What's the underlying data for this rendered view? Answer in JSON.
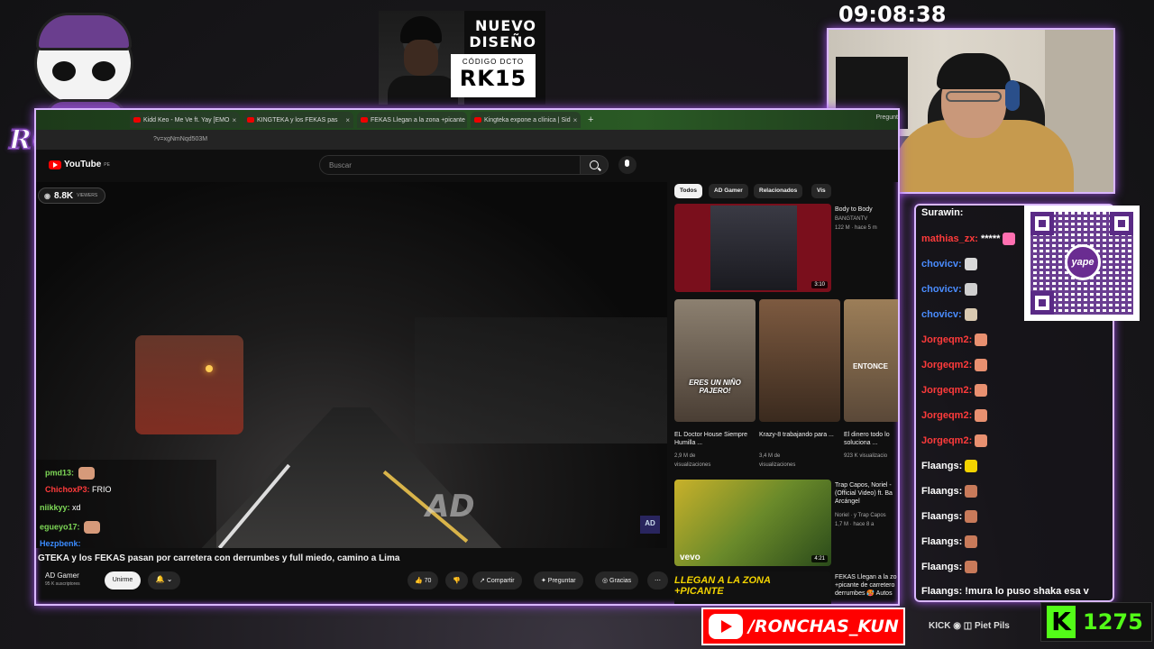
{
  "clock": "09:08:38",
  "logo": {
    "text": "RONCHAS"
  },
  "ad": {
    "line1": "NUEVO",
    "line2": "DISEÑO",
    "code_label": "CÓDIGO DCTO",
    "code": "RK15"
  },
  "browser": {
    "tabs": [
      {
        "label": "Kidd Keo - Me Ve ft. Yay [EMO"
      },
      {
        "label": "KINGTEKA y los FEKAS pas"
      },
      {
        "label": "FEKAS Llegan a la zona +picante"
      },
      {
        "label": "Kingteka expone a clínica | Sid"
      }
    ],
    "new_tab": "+",
    "profile": "Pregunt",
    "url": "?v=xgNmNqd503M"
  },
  "youtube": {
    "logo_text": "YouTube",
    "logo_region": "PE",
    "search_placeholder": "Buscar",
    "viewers": "8.8K",
    "viewers_label": "VIEWERS",
    "watermark": "AD",
    "corner_badge": "AD",
    "video_title": "GTEKA y los FEKAS pasan por carretera con derrumbes y full miedo, camino a Lima",
    "channel": {
      "name": "AD Gamer",
      "subs": "95 K suscriptores"
    },
    "join_label": "Unirme",
    "bell": "🔔 ⌄",
    "actions": {
      "likes": "👍 70",
      "dislike": "👎",
      "share": "↗ Compartir",
      "ask": "✦ Preguntar",
      "thanks": "◎ Gracias",
      "more": "⋯"
    }
  },
  "overlay_chat": [
    {
      "name": "pmd13:",
      "text": "",
      "color": "#7ed957"
    },
    {
      "name": "ChichoxP3:",
      "text": "FRIO",
      "color": "#ff3b3b"
    },
    {
      "name": "niikkyy:",
      "text": "xd",
      "color": "#7ed957"
    },
    {
      "name": "egueyo17:",
      "text": "",
      "color": "#7ed957"
    },
    {
      "name": "Hezpbenk:",
      "text": "",
      "color": "#3b8cff"
    }
  ],
  "recommendations": {
    "chips": [
      "Todos",
      "AD Gamer",
      "Relacionados",
      "Vis"
    ],
    "first": {
      "title": "Body to Body",
      "channel": "BANGTANTV",
      "meta": "122 M · hace 5 m",
      "duration": "3:10"
    },
    "shorts": [
      {
        "caption": "ERES UN NIÑO PAJERO!",
        "title": "EL Doctor House Siempre Humilla ...",
        "views": "2,9 M de",
        "views2": "visualizaciones"
      },
      {
        "caption": "",
        "title": "Krazy-8 trabajando para ...",
        "views": "3,4 M de",
        "views2": "visualizaciones"
      },
      {
        "caption": "ENTONCE",
        "title": "El dinero todo lo soluciona ...",
        "views": "923 K visualizacio",
        "views2": ""
      }
    ],
    "second": {
      "title": "Trap Capos, Noriel - (Official Video) ft. Ba Arcángel",
      "channel": "Noriel · y Trap Capos",
      "meta": "1,7 M · hace 8 a",
      "duration": "4:21",
      "brand": "vevo"
    },
    "third": {
      "banner": "LLEGAN A LA ZONA +PICANTE",
      "title": "FEKAS Llegan a la zo +picante de carretero derrumbes 🥵 Autos"
    }
  },
  "chat": [
    {
      "name": "Surawin:",
      "text": "",
      "color": "#ffffff"
    },
    {
      "name": "mathias_zx:",
      "text": "*****",
      "color": "#ff3b3b"
    },
    {
      "name": "chovicv:",
      "text": "",
      "color": "#4a8cff"
    },
    {
      "name": "chovicv:",
      "text": "",
      "color": "#4a8cff"
    },
    {
      "name": "chovicv:",
      "text": "",
      "color": "#4a8cff"
    },
    {
      "name": "Jorgeqm2:",
      "text": "",
      "color": "#ff3b3b"
    },
    {
      "name": "Jorgeqm2:",
      "text": "",
      "color": "#ff3b3b"
    },
    {
      "name": "Jorgeqm2:",
      "text": "",
      "color": "#ff3b3b"
    },
    {
      "name": "Jorgeqm2:",
      "text": "",
      "color": "#ff3b3b"
    },
    {
      "name": "Jorgeqm2:",
      "text": "",
      "color": "#ff3b3b"
    },
    {
      "name": "Flaangs:",
      "text": "",
      "color": "#ffffff"
    },
    {
      "name": "Flaangs:",
      "text": "",
      "color": "#ffffff"
    },
    {
      "name": "Flaangs:",
      "text": "",
      "color": "#ffffff"
    },
    {
      "name": "Flaangs:",
      "text": "",
      "color": "#ffffff"
    },
    {
      "name": "Flaangs:",
      "text": "",
      "color": "#ffffff"
    },
    {
      "name": "Flaangs:",
      "text": "!mura lo puso shaka esa v",
      "color": "#ffffff"
    }
  ],
  "qr": {
    "brand": "yape"
  },
  "bottom": {
    "youtube_handle": "/RONCHAS_KUN",
    "socials": "KICK ◉ ◫ Piet Pils",
    "kick_letter": "K",
    "kick_count": "1275"
  },
  "colors": {
    "accent": "#d9b7ff",
    "glow": "#9b4fe0",
    "kick": "#53fc18",
    "youtube": "#ff0000"
  }
}
